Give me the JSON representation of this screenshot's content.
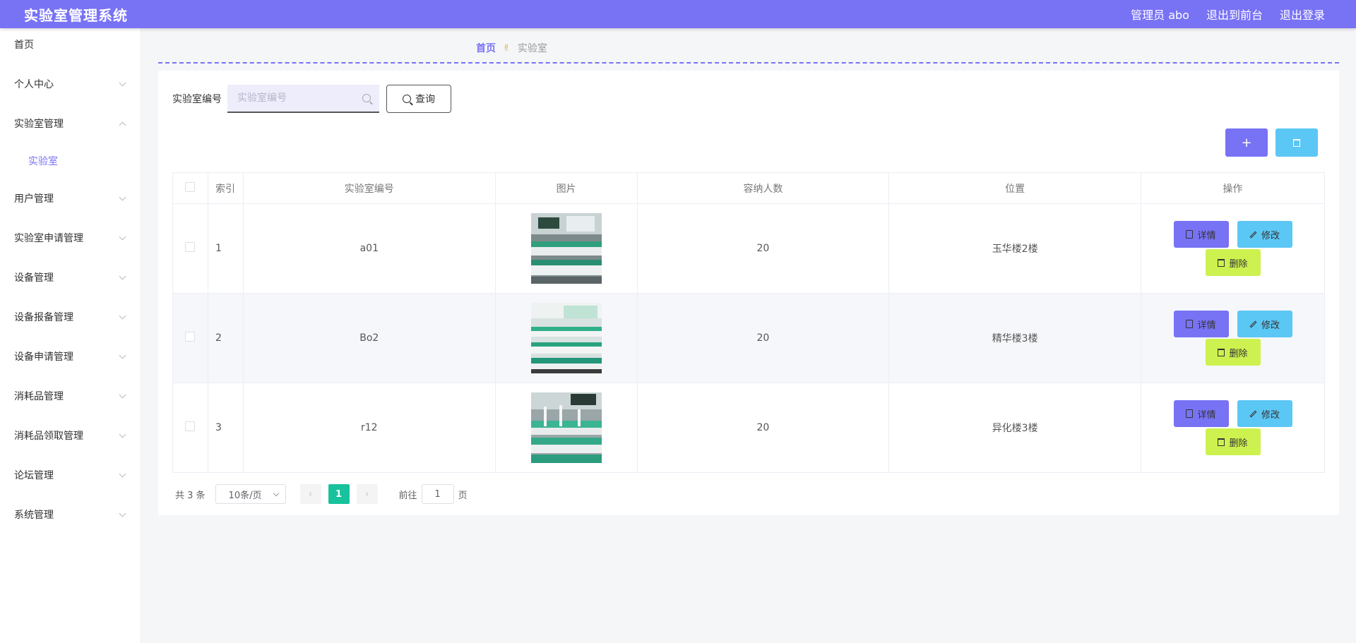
{
  "header": {
    "title": "实验室管理系统",
    "user": "管理员 abo",
    "back_front": "退出到前台",
    "logout": "退出登录"
  },
  "sidebar": {
    "home": "首页",
    "items": [
      {
        "label": "个人中心"
      },
      {
        "label": "实验室管理",
        "expanded": true,
        "children": [
          {
            "label": "实验室"
          }
        ]
      },
      {
        "label": "用户管理"
      },
      {
        "label": "实验室申请管理"
      },
      {
        "label": "设备管理"
      },
      {
        "label": "设备报备管理"
      },
      {
        "label": "设备申请管理"
      },
      {
        "label": "消耗品管理"
      },
      {
        "label": "消耗品领取管理"
      },
      {
        "label": "论坛管理"
      },
      {
        "label": "系统管理"
      }
    ]
  },
  "breadcrumb": {
    "home": "首页",
    "separator": "✌",
    "current": "实验室"
  },
  "search": {
    "label": "实验室编号",
    "placeholder": "实验室编号",
    "value": "",
    "button": "查询"
  },
  "toolbar": {
    "add": "+",
    "delete": "🗑"
  },
  "table": {
    "headers": {
      "index": "索引",
      "code": "实验室编号",
      "image": "图片",
      "capacity": "容纳人数",
      "location": "位置",
      "ops": "操作"
    },
    "rows": [
      {
        "index": "1",
        "code": "a01",
        "capacity": "20",
        "location": "玉华楼2楼"
      },
      {
        "index": "2",
        "code": "Bo2",
        "capacity": "20",
        "location": "精华楼3楼"
      },
      {
        "index": "3",
        "code": "r12",
        "capacity": "20",
        "location": "异化楼3楼"
      }
    ],
    "actions": {
      "detail": "详情",
      "edit": "修改",
      "remove": "删除"
    }
  },
  "pagination": {
    "total": "共 3 条",
    "page_size": "10条/页",
    "current": "1",
    "goto": "前往",
    "goto_value": "1",
    "page_suffix": "页"
  },
  "colors": {
    "primary": "#7872f5",
    "info": "#5bc7f5",
    "lime": "#cdf14f",
    "page_active": "#18c29c"
  }
}
